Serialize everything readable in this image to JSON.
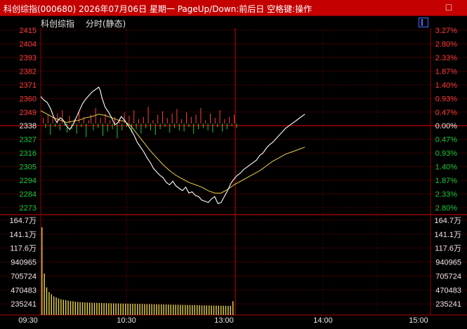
{
  "window": {
    "title": "科创综指(000680)  2026年07月06日  星期一  PageUp/Down:前后日  空格键:操作",
    "close_glyph": "□"
  },
  "header": {
    "name": "科创综指",
    "mode": "分时(静态)"
  },
  "colors": {
    "up": "#ff3b3b",
    "down": "#16c93c",
    "price_line": "#ffffff",
    "avg_line": "#e8d44a",
    "volume": "#e8d44a",
    "grid": "#7a0000",
    "axis_text_neutral": "#e8e8e8",
    "volume_text": "#e8e8e8"
  },
  "chart_data": {
    "type": "line",
    "title": "科创综指 分时(静态)",
    "x_ticks": [
      "09:30",
      "10:30",
      "13:00",
      "14:00",
      "15:00"
    ],
    "price_ticks": [
      "2415",
      "2404",
      "2393",
      "2382",
      "2371",
      "2360",
      "2349",
      "2338",
      "2327",
      "2316",
      "2305",
      "2294",
      "2284",
      "2273"
    ],
    "pct_ticks": [
      "3.27%",
      "2.80%",
      "2.33%",
      "1.87%",
      "1.40%",
      "0.93%",
      "0.47%",
      "0.00%",
      "0.47%",
      "0.93%",
      "1.40%",
      "1.87%",
      "2.33%",
      "2.80%"
    ],
    "volume_ticks": [
      "164.7万",
      "141.1万",
      "117.6万",
      "940965",
      "705724",
      "470483",
      "235241"
    ],
    "prev_close": 2338,
    "price_range": [
      2266,
      2418
    ],
    "volume_max": 1650000,
    "price_series": [
      [
        0,
        2361
      ],
      [
        2,
        2358
      ],
      [
        4,
        2356
      ],
      [
        6,
        2351
      ],
      [
        8,
        2344
      ],
      [
        10,
        2339
      ],
      [
        12,
        2343
      ],
      [
        14,
        2341
      ],
      [
        16,
        2336
      ],
      [
        18,
        2333
      ],
      [
        20,
        2337
      ],
      [
        22,
        2343
      ],
      [
        24,
        2349
      ],
      [
        26,
        2355
      ],
      [
        28,
        2359
      ],
      [
        30,
        2362
      ],
      [
        32,
        2365
      ],
      [
        34,
        2367
      ],
      [
        36,
        2369
      ],
      [
        37,
        2366
      ],
      [
        38,
        2360
      ],
      [
        40,
        2352
      ],
      [
        42,
        2348
      ],
      [
        44,
        2343
      ],
      [
        46,
        2337
      ],
      [
        48,
        2339
      ],
      [
        50,
        2344
      ],
      [
        52,
        2341
      ],
      [
        54,
        2337
      ],
      [
        56,
        2333
      ],
      [
        58,
        2328
      ],
      [
        60,
        2322
      ],
      [
        62,
        2318
      ],
      [
        64,
        2314
      ],
      [
        66,
        2309
      ],
      [
        68,
        2305
      ],
      [
        70,
        2300
      ],
      [
        72,
        2297
      ],
      [
        74,
        2294
      ],
      [
        76,
        2292
      ],
      [
        78,
        2288
      ],
      [
        80,
        2286
      ],
      [
        82,
        2289
      ],
      [
        84,
        2285
      ],
      [
        86,
        2283
      ],
      [
        88,
        2281
      ],
      [
        90,
        2284
      ],
      [
        92,
        2279
      ],
      [
        94,
        2280
      ],
      [
        96,
        2277
      ],
      [
        98,
        2276
      ],
      [
        100,
        2273
      ],
      [
        102,
        2272
      ],
      [
        104,
        2271
      ],
      [
        106,
        2274
      ],
      [
        108,
        2276
      ],
      [
        110,
        2270
      ],
      [
        112,
        2271
      ],
      [
        114,
        2276
      ],
      [
        116,
        2281
      ],
      [
        118,
        2287
      ],
      [
        120,
        2291
      ],
      [
        122,
        2294
      ],
      [
        124,
        2296
      ],
      [
        126,
        2299
      ],
      [
        128,
        2301
      ],
      [
        130,
        2303
      ],
      [
        132,
        2305
      ],
      [
        134,
        2307
      ],
      [
        136,
        2311
      ],
      [
        138,
        2313
      ],
      [
        140,
        2317
      ],
      [
        142,
        2320
      ],
      [
        144,
        2322
      ],
      [
        146,
        2325
      ],
      [
        148,
        2328
      ],
      [
        150,
        2331
      ],
      [
        152,
        2334
      ],
      [
        154,
        2336
      ],
      [
        156,
        2338
      ],
      [
        158,
        2340
      ],
      [
        160,
        2342
      ],
      [
        162,
        2344
      ],
      [
        164,
        2346
      ]
    ],
    "avg_series": [
      [
        0,
        2349
      ],
      [
        4,
        2346
      ],
      [
        8,
        2343
      ],
      [
        12,
        2341
      ],
      [
        16,
        2339
      ],
      [
        20,
        2340
      ],
      [
        24,
        2341
      ],
      [
        28,
        2343
      ],
      [
        32,
        2344
      ],
      [
        36,
        2346
      ],
      [
        40,
        2345
      ],
      [
        44,
        2343
      ],
      [
        48,
        2341
      ],
      [
        52,
        2340
      ],
      [
        56,
        2336
      ],
      [
        60,
        2329
      ],
      [
        64,
        2322
      ],
      [
        68,
        2315
      ],
      [
        72,
        2309
      ],
      [
        76,
        2303
      ],
      [
        80,
        2298
      ],
      [
        84,
        2294
      ],
      [
        88,
        2291
      ],
      [
        92,
        2288
      ],
      [
        96,
        2286
      ],
      [
        100,
        2284
      ],
      [
        104,
        2281
      ],
      [
        108,
        2279
      ],
      [
        112,
        2279
      ],
      [
        116,
        2282
      ],
      [
        120,
        2286
      ],
      [
        124,
        2289
      ],
      [
        128,
        2292
      ],
      [
        132,
        2295
      ],
      [
        136,
        2298
      ],
      [
        140,
        2302
      ],
      [
        144,
        2306
      ],
      [
        148,
        2309
      ],
      [
        152,
        2312
      ],
      [
        156,
        2314
      ],
      [
        160,
        2316
      ],
      [
        164,
        2318
      ]
    ],
    "volume_series": [
      1650000,
      780000,
      520000,
      430000,
      390000,
      350000,
      330000,
      310000,
      295000,
      285000,
      280000,
      270000,
      262000,
      258000,
      250000,
      245000,
      242000,
      238000,
      236000,
      234000,
      232000,
      230000,
      229000,
      228000,
      226000,
      225000,
      224000,
      222000,
      221000,
      220000,
      219000,
      218000,
      217000,
      216000,
      215000,
      214000,
      213000,
      212000,
      211000,
      210000,
      209000,
      208000,
      207000,
      206000,
      205000,
      204000,
      203000,
      202000,
      201000,
      200000,
      199000,
      198000,
      197000,
      196000,
      195000,
      194000,
      193000,
      192000,
      191000,
      190000,
      189000,
      188000,
      187000,
      186000,
      185000,
      184000,
      183000,
      182000,
      181000,
      180000,
      179000,
      178000,
      177000,
      176000,
      175000,
      174000,
      173000,
      172000,
      171000,
      170000,
      260000
    ],
    "breadth_series": [
      5,
      -4,
      8,
      -10,
      6,
      -3,
      9,
      -6,
      12,
      -2,
      -8,
      7,
      -5,
      4,
      -9,
      10,
      -3,
      6,
      -12,
      3,
      8,
      -6,
      14,
      -4,
      5,
      -11,
      9,
      -7,
      3,
      -5,
      6,
      -13,
      4,
      -6,
      10,
      -3,
      7,
      -8,
      12,
      -5,
      4,
      -9,
      6,
      -4,
      15,
      -6,
      3,
      -10,
      8,
      -5,
      11,
      -3,
      5,
      -8,
      9,
      -4,
      13,
      -6,
      4,
      -7,
      10,
      -3,
      6,
      -9,
      8,
      -5,
      14,
      -4,
      3,
      -6,
      9,
      -8,
      5,
      -3,
      12,
      -7,
      4,
      -5,
      6,
      -2,
      8,
      -4
    ]
  }
}
